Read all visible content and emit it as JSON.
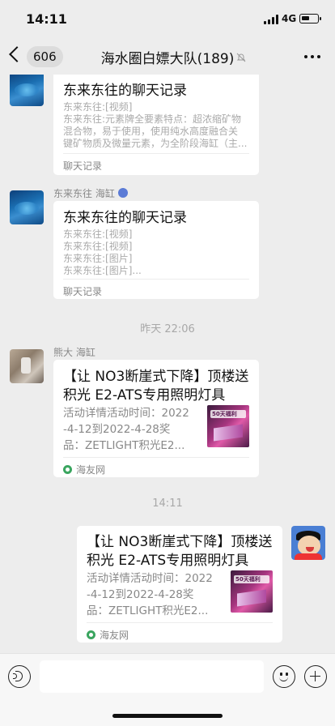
{
  "status_bar": {
    "time": "14:11",
    "network": "4G",
    "battery_level": 0.55
  },
  "nav": {
    "back_count": "606",
    "title": "海水圈白嫖大队(189)",
    "muted": true
  },
  "messages": [
    {
      "type": "chat_record",
      "sender": "",
      "title": "东来东往的聊天记录",
      "lines": [
        "东来东往:[视频]",
        "东来东往:元素牌全要素特点：超浓缩矿物",
        "混合物，易于使用，使用纯水高度融合关",
        "键矿物质及微量元素，为全阶段海缸（主..."
      ],
      "footer": "聊天记录"
    },
    {
      "type": "chat_record",
      "sender": "东来东往 海缸",
      "title": "东来东往的聊天记录",
      "lines": [
        "东来东往:[视频]",
        "东来东往:[视频]",
        "东来东往:[图片]",
        "东来东往:[图片]..."
      ],
      "footer": "聊天记录"
    },
    {
      "type": "time",
      "text": "昨天 22:06"
    },
    {
      "type": "link",
      "sender": "熊大 海缸",
      "title_lines": [
        "【让 NO3断崖式下降】顶楼送",
        "积光 E2-ATS专用照明灯具"
      ],
      "desc_lines": [
        "活动详情活动时间：2022",
        "-4-12到2022-4-28奖",
        "品：ZETLIGHT积光E2..."
      ],
      "thumb_text": "50天福利",
      "source": "海友网"
    },
    {
      "type": "time",
      "text": "14:11"
    },
    {
      "type": "link",
      "sender": "",
      "title_lines": [
        "【让 NO3断崖式下降】顶楼送",
        "积光 E2-ATS专用照明灯具"
      ],
      "desc_lines": [
        "活动详情活动时间：2022",
        "-4-12到2022-4-28奖",
        "品：ZETLIGHT积光E2..."
      ],
      "thumb_text": "50天福利",
      "source": "海友网"
    }
  ],
  "input": {
    "value": "",
    "placeholder": ""
  },
  "icons": {
    "back": "chevron-left-icon",
    "mute": "bell-off-icon",
    "more": "more-dots-icon",
    "voice": "voice-icon",
    "emoji": "emoji-icon",
    "plus": "plus-icon"
  }
}
